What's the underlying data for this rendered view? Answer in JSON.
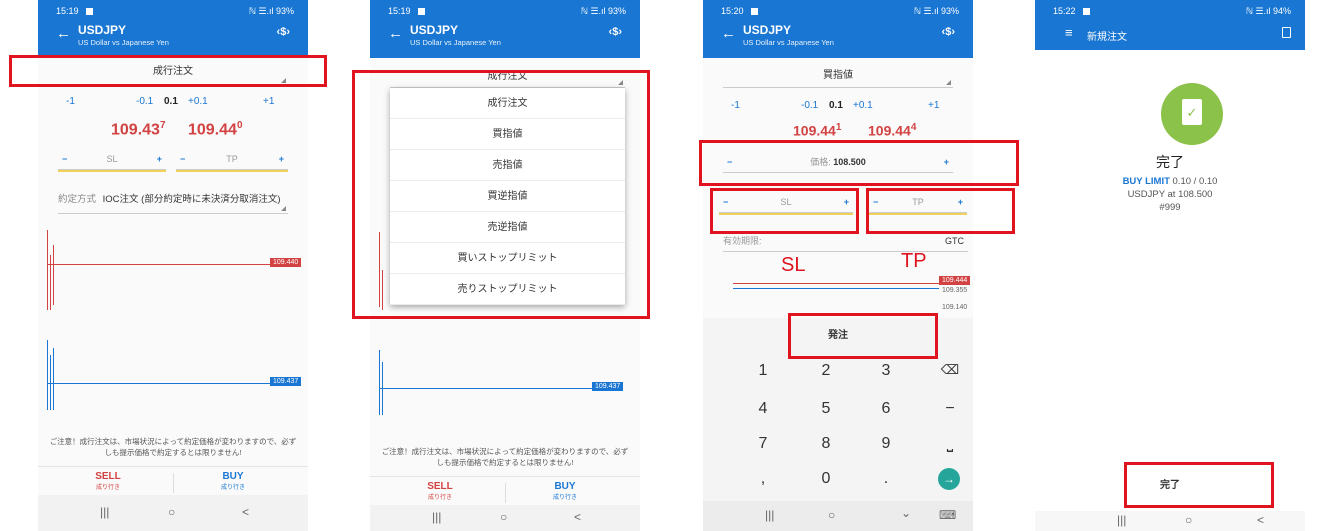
{
  "screen1": {
    "status_time": "15:19",
    "status_right": "ℕ ☰.ıl 93%",
    "symbol": "USDJPY",
    "symbol_desc": "US Dollar vs Japanese Yen",
    "order_type": "成行注文",
    "volume_steps": [
      "-1",
      "-0.1",
      "0.1",
      "+0.1",
      "+1"
    ],
    "sell_price_main": "109.43",
    "sell_price_sup": "7",
    "buy_price_main": "109.44",
    "buy_price_sup": "0",
    "sl_label": "SL",
    "tp_label": "TP",
    "minus": "−",
    "plus": "+",
    "fill_policy_label": "約定方式",
    "fill_policy_value": "IOC注文 (部分約定時に未決済分取消注文)",
    "chart_bid_tag": "109.440",
    "chart_ask_tag": "109.437",
    "notice": "ご注意！成行注文は、市場状況によって約定価格が変わりますので、必ずしも提示価格で約定するとは限りません!",
    "sell_label": "SELL",
    "sell_sub": "成り行き",
    "buy_label": "BUY",
    "buy_sub": "成り行き",
    "nav_recent": "|||",
    "nav_home": "○",
    "nav_back": "<"
  },
  "screen2": {
    "status_time": "15:19",
    "status_right": "ℕ ☰.ıl 93%",
    "symbol": "USDJPY",
    "symbol_desc": "US Dollar vs Japanese Yen",
    "order_type": "成行注文",
    "menu_items": [
      "成行注文",
      "買指値",
      "売指値",
      "買逆指値",
      "売逆指値",
      "買いストップリミット",
      "売りストップリミット"
    ],
    "chart_ask_tag": "109.437",
    "notice": "ご注意！成行注文は、市場状況によって約定価格が変わりますので、必ずしも提示価格で約定するとは限りません!",
    "sell_label": "SELL",
    "sell_sub": "成り行き",
    "buy_label": "BUY",
    "buy_sub": "成り行き",
    "nav_recent": "|||",
    "nav_home": "○",
    "nav_back": "<"
  },
  "screen3": {
    "status_time": "15:20",
    "status_right": "ℕ ☰.ıl 93%",
    "symbol": "USDJPY",
    "symbol_desc": "US Dollar vs Japanese Yen",
    "order_type": "買指値",
    "volume_steps": [
      "-1",
      "-0.1",
      "0.1",
      "+0.1",
      "+1"
    ],
    "sell_price_main": "109.44",
    "sell_price_sup": "1",
    "buy_price_main": "109.44",
    "buy_price_sup": "4",
    "price_label": "価格:",
    "price_value": "108.500",
    "sl_label": "SL",
    "tp_label": "TP",
    "minus": "−",
    "plus": "+",
    "expiry_label": "有効期限:",
    "expiry_value": "GTC",
    "annot_sl": "SL",
    "annot_tp": "TP",
    "chart_tag_1": "109.444",
    "chart_tag_2": "109.355",
    "chart_tag_3": "109.140",
    "send_label": "発注",
    "keys": [
      "1",
      "2",
      "3",
      "⌫",
      "4",
      "5",
      "6",
      "−",
      "7",
      "8",
      "9",
      "⎵",
      ",",
      "0",
      ".",
      "→"
    ],
    "nav_recent": "|||",
    "nav_home": "○",
    "nav_back": "⌄",
    "nav_kbd": "⌨"
  },
  "screen4": {
    "status_time": "15:22",
    "status_right": "ℕ ☰.ıl 94%",
    "menu_icon": "≡",
    "title": "新規注文",
    "done_title": "完了",
    "order_line_bold": "BUY LIMIT",
    "order_line_rest": "0.10 / 0.10",
    "order_symbol_line": "USDJPY at 108.500",
    "order_number": "#999",
    "done_button": "完了",
    "nav_recent": "|||",
    "nav_home": "○",
    "nav_back": "<"
  },
  "colors": {
    "appbar": "#1976d2",
    "accent_red": "#e0141e",
    "sell_red": "#d24242",
    "buy_blue": "#1976d2",
    "done_green": "#8bc34a"
  }
}
